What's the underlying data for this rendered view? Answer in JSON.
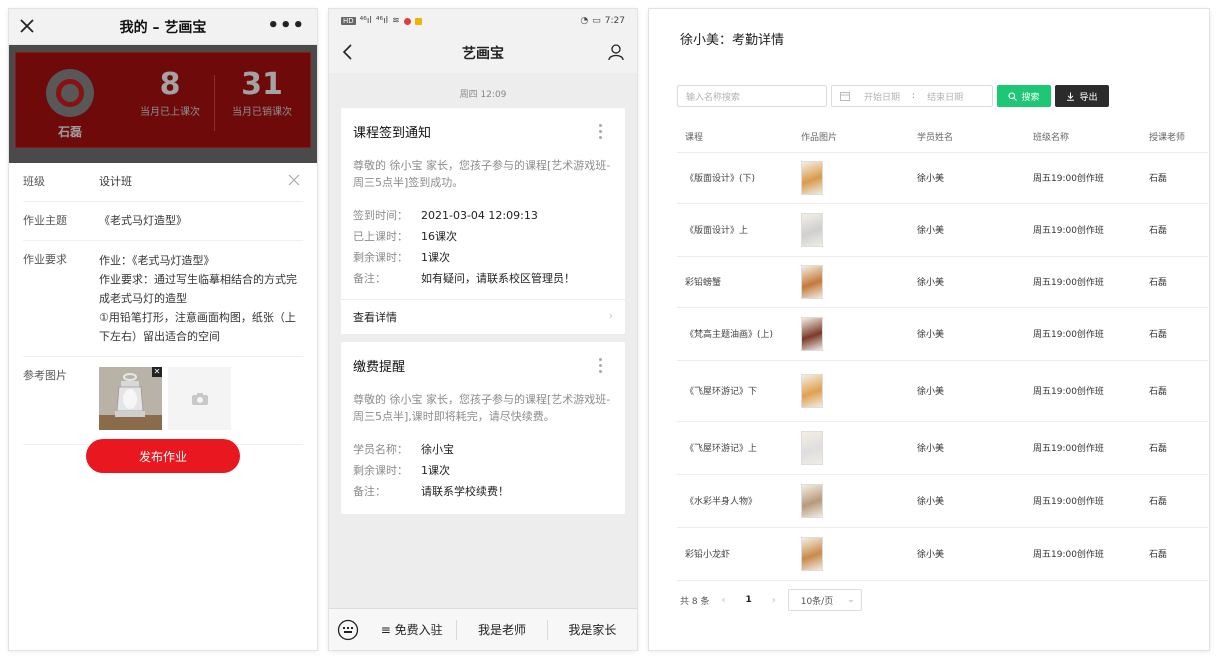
{
  "panel1": {
    "title": "我的 – 艺画宝",
    "more": "•••",
    "logo_name": "石磊",
    "stats": [
      {
        "num": "8",
        "label": "当月已上课次"
      },
      {
        "num": "31",
        "label": "当月已销课次"
      }
    ],
    "form": {
      "class_label": "班级",
      "class_value": "设计班",
      "topic_label": "作业主题",
      "topic_value": "《老式马灯造型》",
      "req_label": "作业要求",
      "req_lines": [
        "作业：《老式马灯造型》",
        "作业要求：通过写生临摹相结合的方式完",
        "成老式马灯的造型",
        "①用铅笔打形，注意画面构图，纸张（上",
        "下左右）留出适合的空间"
      ],
      "ref_label": "参考图片"
    },
    "publish_button": "发布作业"
  },
  "panel2": {
    "status": {
      "hd": "HD",
      "signal1": "⁴⁶ıl",
      "signal2": "⁴⁶ıl",
      "time": "7:27"
    },
    "title": "艺画宝",
    "timestamp": "周四 12:09",
    "msg1": {
      "title": "课程签到通知",
      "desc": "尊敬的 徐小宝 家长，您孩子参与的课程[艺术游戏班-周三5点半]签到成功。",
      "fields": [
        {
          "k": "签到时间：",
          "v": "2021-03-04 12:09:13"
        },
        {
          "k": "已上课时：",
          "v": "16课次"
        },
        {
          "k": "剩余课时：",
          "v": "1课次"
        },
        {
          "k": "备注：",
          "v": "如有疑问，请联系校区管理员！"
        }
      ],
      "detail": "查看详情",
      "chevron": "›"
    },
    "msg2": {
      "title": "缴费提醒",
      "desc": "尊敬的 徐小宝 家长，您孩子参与的课程[艺术游戏班-周三5点半],课时即将耗完，请尽快续费。",
      "fields": [
        {
          "k": "学员名称：",
          "v": "徐小宝"
        },
        {
          "k": "剩余课时：",
          "v": "1课次"
        },
        {
          "k": "备注：",
          "v": "请联系学校续费！"
        }
      ]
    },
    "tabs": [
      "≡ 免费入驻",
      "我是老师",
      "我是家长"
    ]
  },
  "panel3": {
    "title": "徐小美：考勤详情",
    "search_placeholder": "输入名称搜索",
    "date_start": "开始日期",
    "date_sep": ":",
    "date_end": "结束日期",
    "search_button": "搜索",
    "export_button": "导出",
    "columns": [
      "课程",
      "作品图片",
      "学员姓名",
      "班级名称",
      "授课老师"
    ],
    "rows": [
      {
        "course": "《版面设计》(下)",
        "student": "徐小美",
        "class": "周五19:00创作班",
        "teacher": "石磊",
        "art": "#d99a4a"
      },
      {
        "course": "《版面设计》上",
        "student": "徐小美",
        "class": "周五19:00创作班",
        "teacher": "石磊",
        "art": "#cfcfcf"
      },
      {
        "course": "彩铅螃蟹",
        "student": "徐小美",
        "class": "周五19:00创作班",
        "teacher": "石磊",
        "art": "#c47a3a"
      },
      {
        "course": "《梵高主题油画》(上)",
        "student": "徐小美",
        "class": "周五19:00创作班",
        "teacher": "石磊",
        "art": "#7a3a2a"
      },
      {
        "course": "《飞屋环游记》下",
        "student": "徐小美",
        "class": "周五19:00创作班",
        "teacher": "石磊",
        "art": "#e0a050"
      },
      {
        "course": "《飞屋环游记》上",
        "student": "徐小美",
        "class": "周五19:00创作班",
        "teacher": "石磊",
        "art": "#dedede"
      },
      {
        "course": "《水彩半身人物》",
        "student": "徐小美",
        "class": "周五19:00创作班",
        "teacher": "石磊",
        "art": "#b79a7a"
      },
      {
        "course": "彩铅小龙虾",
        "student": "徐小美",
        "class": "周五19:00创作班",
        "teacher": "石磊",
        "art": "#c98a4a"
      }
    ],
    "pager": {
      "total": "共 8 条",
      "prev": "‹",
      "page": "1",
      "next": "›",
      "page_size": "10条/页",
      "size_chevron": "⌄"
    }
  },
  "colors": {
    "publish": "#e9171f",
    "search": "#1ec776",
    "export": "#2b2b2b"
  }
}
